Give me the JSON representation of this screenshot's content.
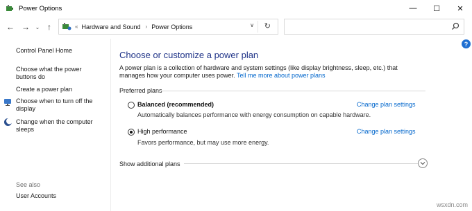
{
  "window": {
    "title": "Power Options",
    "minimize": "—",
    "maximize": "☐",
    "close": "✕"
  },
  "nav": {
    "back": "←",
    "forward": "→",
    "up": "↑",
    "crumb_overflow": "«",
    "crumb1": "Hardware and Sound",
    "crumb_sep": "›",
    "crumb2": "Power Options",
    "dropdown": "∨",
    "refresh": "↻",
    "search_placeholder": ""
  },
  "sidebar": {
    "home": "Control Panel Home",
    "link1_line1": "Choose what the power",
    "link1_line2": "buttons do",
    "link2": "Create a power plan",
    "link3_line1": "Choose when to turn off the",
    "link3_line2": "display",
    "link4_line1": "Change when the computer",
    "link4_line2": "sleeps",
    "see_also": "See also",
    "user_accounts": "User Accounts"
  },
  "main": {
    "title": "Choose or customize a power plan",
    "description": "A power plan is a collection of hardware and system settings (like display brightness, sleep, etc.) that manages how your computer uses power.",
    "tell_me_more": "Tell me more about power plans",
    "preferred_plans": "Preferred plans",
    "plans": [
      {
        "name": "Balanced (recommended)",
        "description": "Automatically balances performance with energy consumption on capable hardware.",
        "link": "Change plan settings",
        "selected": false
      },
      {
        "name": "High performance",
        "description": "Favors performance, but may use more energy.",
        "link": "Change plan settings",
        "selected": true
      }
    ],
    "show_additional": "Show additional plans",
    "help": "?"
  },
  "watermark": "wsxdn.com"
}
